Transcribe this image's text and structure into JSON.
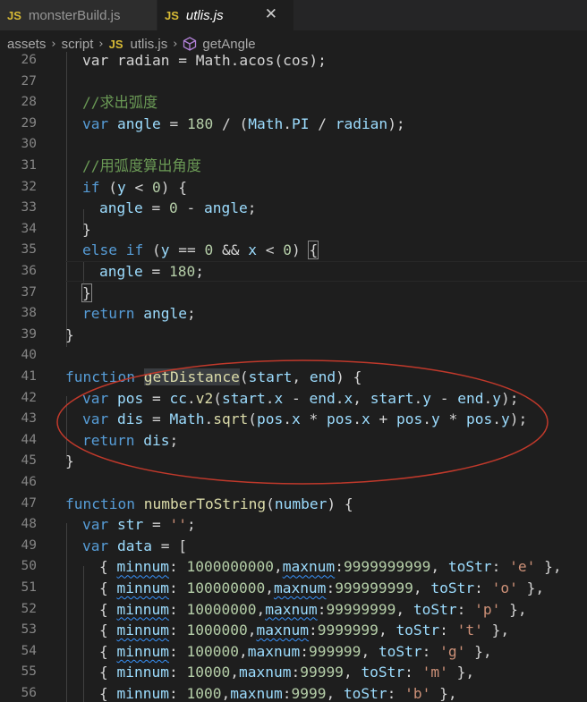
{
  "tabs": [
    {
      "badge": "JS",
      "label": "monsterBuild.js"
    },
    {
      "badge": "JS",
      "label": "utlis.js",
      "close": "✕"
    }
  ],
  "breadcrumb": {
    "items": [
      "assets",
      "script",
      "utlis.js",
      "getAngle"
    ],
    "sep": "›",
    "badge": "JS"
  },
  "code": {
    "line_numbers": [
      "26",
      "27",
      "28",
      "29",
      "30",
      "31",
      "32",
      "33",
      "34",
      "35",
      "36",
      "37",
      "38",
      "39",
      "40",
      "41",
      "42",
      "43",
      "44",
      "45",
      "46",
      "47",
      "48",
      "49",
      "50",
      "51",
      "52",
      "53",
      "54",
      "55",
      "56"
    ]
  },
  "colors": {
    "background": "#1e1e1e",
    "keyword": "#569cd6",
    "function": "#dcdcaa",
    "variable": "#9cdcfe",
    "number": "#b5cea8",
    "string": "#ce9178",
    "comment": "#6a9955",
    "annotation": "#c0392b"
  },
  "annotation": {
    "shape": "red-ellipse",
    "target_lines": "41-44"
  }
}
